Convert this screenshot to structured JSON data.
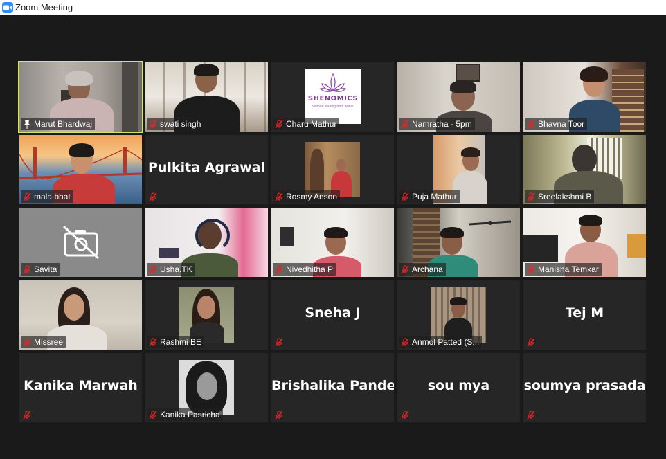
{
  "window": {
    "title": "Zoom Meeting"
  },
  "icons": {
    "app": "zoom-camera-icon",
    "muted": "mic-muted-icon",
    "pin": "pin-icon",
    "camera_off": "camera-off-icon"
  },
  "colors": {
    "active_speaker_border": "#d4e56a",
    "tile_bg": "#262626",
    "gallery_bg": "#1a1a1a"
  },
  "participants": [
    {
      "name": "Marut Bhardwaj",
      "display": "video",
      "active": true,
      "pinned": true
    },
    {
      "name": "swati singh",
      "display": "video",
      "muted": true
    },
    {
      "name": "Charu Mathur",
      "display": "logo",
      "muted": true,
      "logo_text": "SHENOMICS",
      "logo_sub": "women leading from within"
    },
    {
      "name": "Namratha - 5pm",
      "display": "video",
      "muted": true
    },
    {
      "name": "Bhavna Toor",
      "display": "video",
      "muted": true
    },
    {
      "name": "mala bhat",
      "display": "video",
      "muted": true
    },
    {
      "name": "Pulkita Agrawal",
      "display": "name",
      "muted": true
    },
    {
      "name": "Rosmy Anson",
      "display": "video",
      "muted": true
    },
    {
      "name": "Puja Mathur",
      "display": "video",
      "muted": true
    },
    {
      "name": "Sreelakshmi B",
      "display": "video",
      "muted": true
    },
    {
      "name": "Savita",
      "display": "camera-off",
      "muted": true
    },
    {
      "name": "Usha.TK",
      "display": "video",
      "muted": true
    },
    {
      "name": "Nivedhitha P",
      "display": "video",
      "muted": true
    },
    {
      "name": "Archana",
      "display": "video",
      "muted": true
    },
    {
      "name": "Manisha Temkar",
      "display": "video",
      "muted": true
    },
    {
      "name": "Missree",
      "display": "video",
      "muted": true
    },
    {
      "name": "Rashmi BE",
      "display": "photo",
      "muted": true
    },
    {
      "name": "Sneha J",
      "display": "name",
      "muted": true
    },
    {
      "name": "Anmol Patted (S...",
      "display": "photo",
      "muted": true
    },
    {
      "name": "Tej M",
      "display": "name",
      "muted": true
    },
    {
      "name": "Kanika Marwah",
      "display": "name",
      "muted": true
    },
    {
      "name": "Kanika Pasricha",
      "display": "photo",
      "muted": true
    },
    {
      "name": "Brishalika Pandey",
      "display": "name",
      "muted": true
    },
    {
      "name": "sou mya",
      "display": "name",
      "muted": true
    },
    {
      "name": "soumya prasada",
      "display": "name",
      "muted": true
    }
  ]
}
